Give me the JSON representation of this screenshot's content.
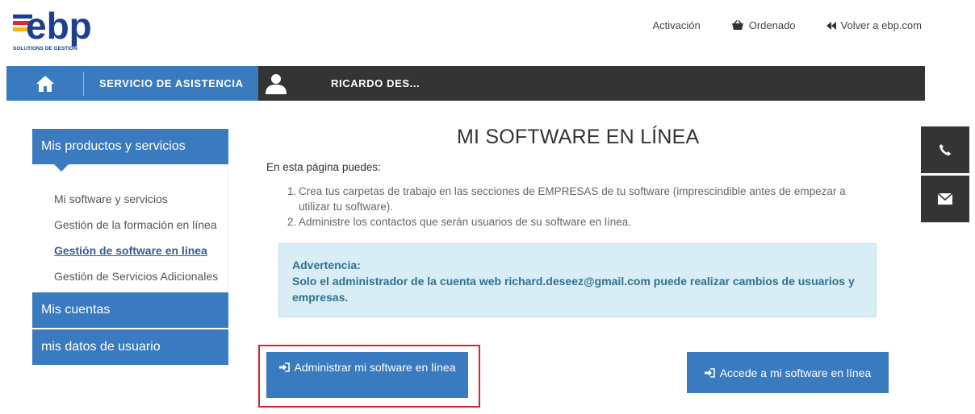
{
  "brand": {
    "logo_text": "ebp",
    "logo_tagline": "SOLUTIONS DE GESTION"
  },
  "top_links": [
    {
      "label": "Activación",
      "icon": ""
    },
    {
      "label": "Ordenado",
      "icon": "basket-icon"
    },
    {
      "label": "Volver a ebp.com",
      "icon": "double-chevron-left-icon"
    }
  ],
  "navbar": {
    "home_icon": "home-icon",
    "service_label": "SERVICIO DE ASISTENCIA",
    "user_icon": "user-icon",
    "user_label": "RICARDO DES..."
  },
  "sidebar": {
    "active_label": "Mis productos y servicios",
    "sub_items": [
      {
        "label": "Mi software y servicios",
        "current": false
      },
      {
        "label": "Gestión de la formación en línea",
        "current": false
      },
      {
        "label": "Gestión de software en línea",
        "current": true
      },
      {
        "label": "Gestión de Servicios Adicionales",
        "current": false
      }
    ],
    "buttons": [
      "Mis cuentas",
      "mis datos de usuario"
    ]
  },
  "main": {
    "title": "MI SOFTWARE EN LÍNEA",
    "intro": "En esta página puedes:",
    "steps": [
      {
        "num": "1.",
        "text": "Crea tus carpetas de trabajo en las secciones de EMPRESAS de tu software (imprescindible antes de empezar a utilizar tu software)."
      },
      {
        "num": "2.",
        "text": "Administre los contactos que serán usuarios de su software en línea."
      }
    ],
    "alert_title": "Advertencia:",
    "alert_text": "Solo el administrador de la cuenta web richard.deseez@gmail.com puede realizar cambios de usuarios y empresas.",
    "btn_admin": "Administrar mi software en línea",
    "btn_access": "Accede a mi software en línea"
  },
  "floating": {
    "phone_icon": "phone-icon",
    "mail_icon": "mail-icon"
  },
  "colors": {
    "primary_blue": "#3a7abf",
    "dark_nav": "#343434",
    "alert_bg": "#d9edf7",
    "alert_text": "#31708f",
    "highlight_red": "#d9232d",
    "logo_blue": "#1d3f8e",
    "logo_red": "#e3262e",
    "logo_yellow": "#f5b800"
  }
}
